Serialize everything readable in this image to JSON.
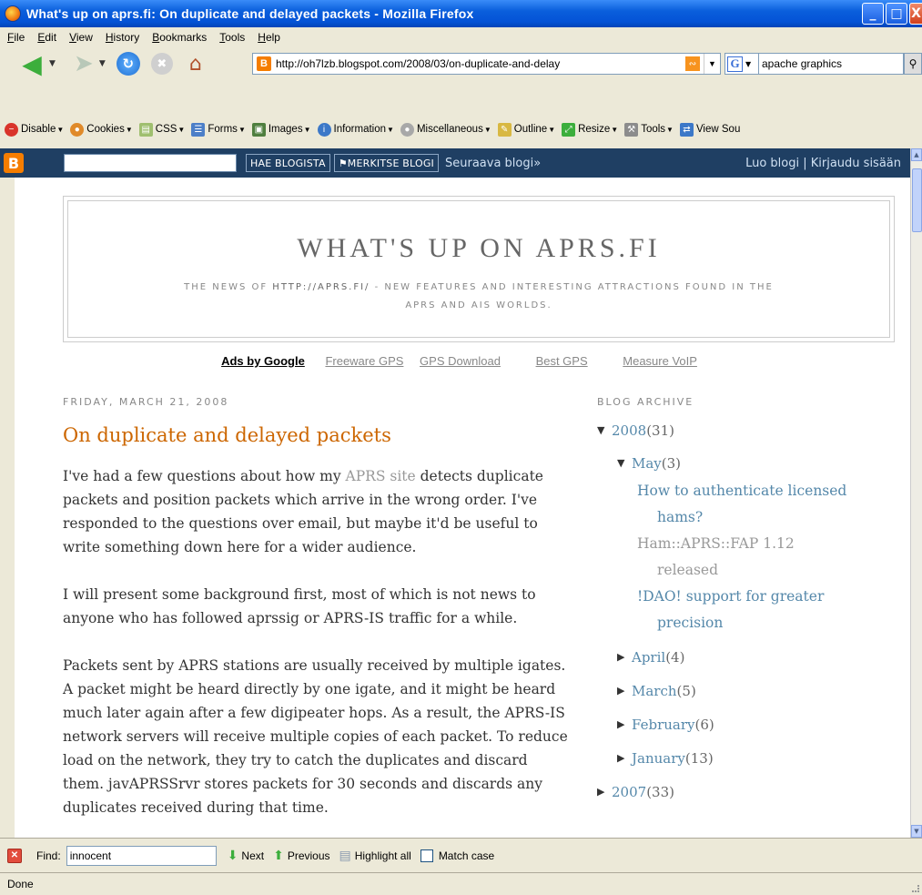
{
  "window": {
    "title": "What's up on aprs.fi: On duplicate and delayed packets - Mozilla Firefox",
    "minimize": "_",
    "maximize": "□",
    "close": "X"
  },
  "menu": [
    "File",
    "Edit",
    "View",
    "History",
    "Bookmarks",
    "Tools",
    "Help"
  ],
  "navbar": {
    "url": "http://oh7lzb.blogspot.com/2008/03/on-duplicate-and-delay",
    "search_value": "apache graphics"
  },
  "devbar": [
    {
      "label": "Disable",
      "color": "#d9342b"
    },
    {
      "label": "Cookies",
      "color": "#e08a2a"
    },
    {
      "label": "CSS",
      "color": "#9fbf6f"
    },
    {
      "label": "Forms",
      "color": "#4c7fc8"
    },
    {
      "label": "Images",
      "color": "#4f7f3f"
    },
    {
      "label": "Information",
      "color": "#3c78c8"
    },
    {
      "label": "Miscellaneous",
      "color": "#a8a8a8"
    },
    {
      "label": "Outline",
      "color": "#d8b842"
    },
    {
      "label": "Resize",
      "color": "#3cae3c"
    },
    {
      "label": "Tools",
      "color": "#8c8c8c"
    },
    {
      "label": "View Sou",
      "color": "#3c78c8"
    }
  ],
  "blogger_nav": {
    "logo": "B",
    "search_button": "HAE BLOGISTA",
    "flag_button": "⚑MERKITSE BLOGI",
    "next_blog": "Seuraava blogi»",
    "right_links": "Luo blogi | Kirjaudu sisään"
  },
  "blog": {
    "title": "WHAT'S UP ON APRS.FI",
    "description_pre": "THE NEWS OF ",
    "description_link": "HTTP://APRS.FI/",
    "description_post": " - NEW FEATURES AND INTERESTING ATTRACTIONS FOUND IN THE APRS AND AIS WORLDS."
  },
  "ads": {
    "label": "Ads by Google",
    "links": [
      "Freeware GPS",
      "GPS Download",
      "Best GPS",
      "Measure VoIP"
    ]
  },
  "post": {
    "date": "FRIDAY, MARCH 21, 2008",
    "title": "On duplicate and delayed packets",
    "p1_pre": "I've had a few questions about how my ",
    "p1_link": "APRS site",
    "p1_post": " detects duplicate packets and position packets which arrive in the wrong order. I've responded to the questions over email, but maybe it'd be useful to write something down here for a wider audience.",
    "p2": "I will present some background first, most of which is not news to anyone who has followed aprssig or APRS-IS traffic for a while.",
    "p3": "Packets sent by APRS stations are usually received by multiple igates. A packet might be heard directly by one igate, and it might be heard much later again after a few digipeater hops. As a result, the APRS-IS network servers will receive multiple copies of each packet. To reduce load on the network, they try to catch the duplicates and discard them. javAPRSSrvr stores packets for 30 seconds and discards any duplicates received during that time."
  },
  "sidebar": {
    "heading": "BLOG ARCHIVE",
    "year_2008": {
      "label": "2008",
      "count": "(31)"
    },
    "may": {
      "label": "May",
      "count": "(3)"
    },
    "may_posts": [
      {
        "l1": "How to authenticate licensed",
        "l2": "hams?"
      },
      {
        "l1": "Ham::APRS::FAP 1.12",
        "l2": "released"
      },
      {
        "l1": "!DAO! support for greater",
        "l2": "precision"
      }
    ],
    "months": [
      {
        "label": "April",
        "count": "(4)"
      },
      {
        "label": "March",
        "count": "(5)"
      },
      {
        "label": "February",
        "count": "(6)"
      },
      {
        "label": "January",
        "count": "(13)"
      }
    ],
    "year_2007": {
      "label": "2007",
      "count": "(33)"
    }
  },
  "findbar": {
    "label": "Find:",
    "value": "innocent",
    "next": "Next",
    "previous": "Previous",
    "highlight": "Highlight all",
    "match_case": "Match case"
  },
  "status": "Done"
}
